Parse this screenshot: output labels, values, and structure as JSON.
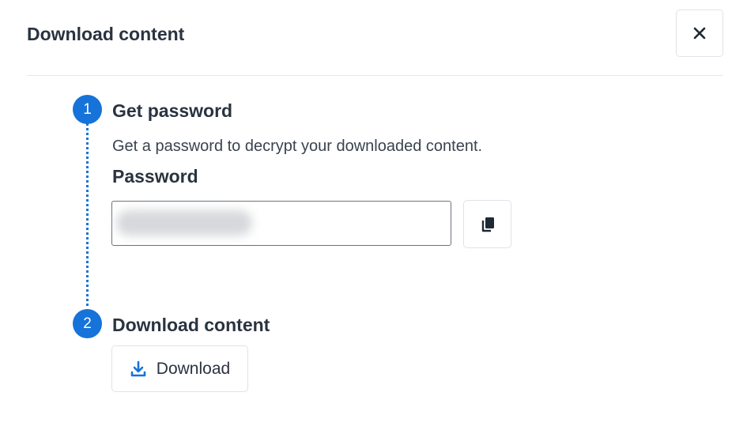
{
  "dialog": {
    "title": "Download content",
    "close_icon": "close-icon"
  },
  "steps": [
    {
      "number": "1",
      "title": "Get password",
      "description": "Get a password to decrypt your downloaded content.",
      "field_label": "Password",
      "password_value": "",
      "copy_icon": "copy-icon"
    },
    {
      "number": "2",
      "title": "Download content",
      "button_label": "Download",
      "download_icon": "download-icon"
    }
  ],
  "colors": {
    "accent": "#1573d9",
    "text": "#2a3340",
    "border": "#dfe3e8"
  }
}
